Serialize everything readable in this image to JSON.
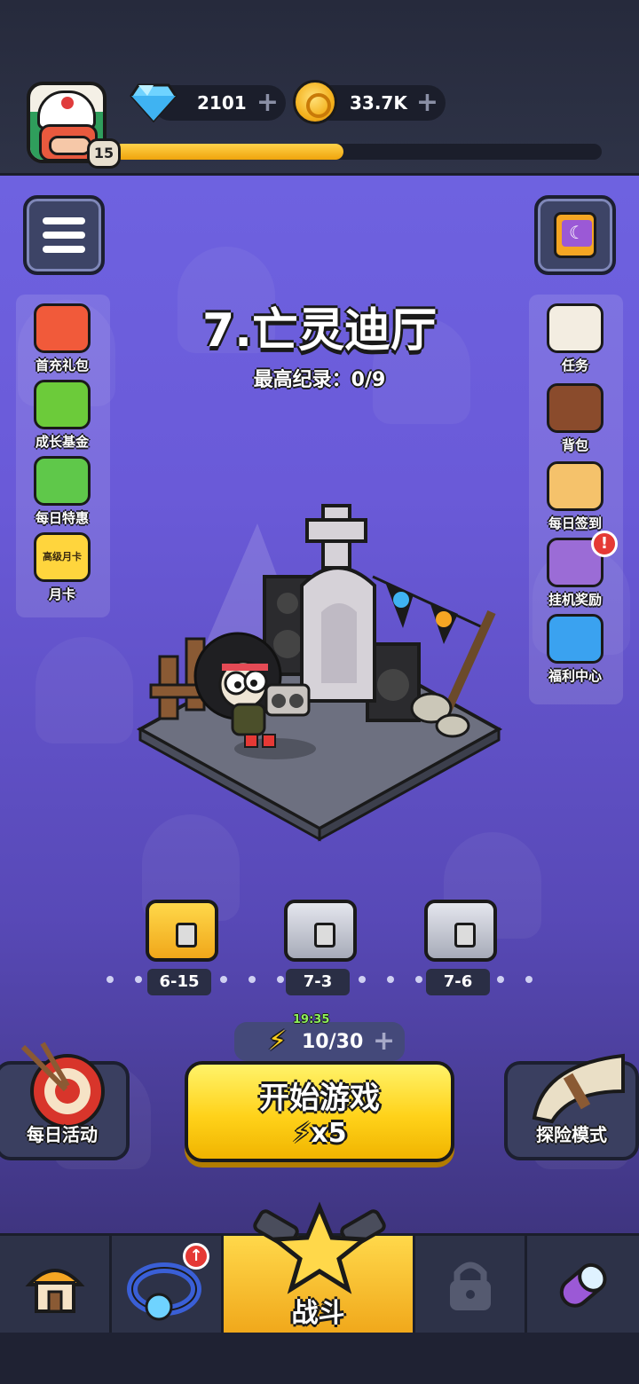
{
  "player": {
    "level": "15",
    "xp_progress": 0.47
  },
  "currencies": {
    "gems": {
      "icon": "diamond-icon",
      "value": "2101"
    },
    "coins": {
      "icon": "coin-icon",
      "value": "33.7K"
    }
  },
  "stage": {
    "title": "7.亡灵迪厅",
    "record": "最高纪录：0/9"
  },
  "left_menu": [
    {
      "label": "首充礼包",
      "icon": "gift-box-icon",
      "color": "#f15a3a"
    },
    {
      "label": "成长基金",
      "icon": "growth-arrow-icon",
      "color": "#6ccb3a"
    },
    {
      "label": "每日特惠",
      "icon": "basket-icon",
      "color": "#5fc84a"
    },
    {
      "label": "月卡",
      "sublabel": "高级月卡",
      "icon": "card-icon",
      "color": "#ffd53d"
    }
  ],
  "right_menu": [
    {
      "label": "任务",
      "icon": "scroll-icon",
      "color": "#f3ede1"
    },
    {
      "label": "背包",
      "icon": "backpack-icon",
      "color": "#8a4b2c"
    },
    {
      "label": "每日签到",
      "icon": "clipboard-check-icon",
      "color": "#f5c26b"
    },
    {
      "label": "挂机奖励",
      "icon": "hourglass-icon",
      "color": "#9b6cd6",
      "alert": "!"
    },
    {
      "label": "福利中心",
      "icon": "megaphone-icon",
      "color": "#3aa2f0"
    }
  ],
  "chests": [
    {
      "label": "6-15",
      "type": "gold"
    },
    {
      "label": "7-3",
      "type": "silver"
    },
    {
      "label": "7-6",
      "type": "silver"
    }
  ],
  "energy": {
    "timer": "19:35",
    "count": "10/30"
  },
  "start_button": {
    "label": "开始游戏",
    "cost": "x5"
  },
  "side_modes": {
    "daily": "每日活动",
    "explore": "探险模式"
  },
  "nav": [
    {
      "icon": "shop-house-icon",
      "label": ""
    },
    {
      "icon": "ring-equipment-icon",
      "label": ""
    },
    {
      "icon": "star-battle-icon",
      "label": "战斗"
    },
    {
      "icon": "lock-icon",
      "label": ""
    },
    {
      "icon": "capsule-icon",
      "label": ""
    }
  ]
}
